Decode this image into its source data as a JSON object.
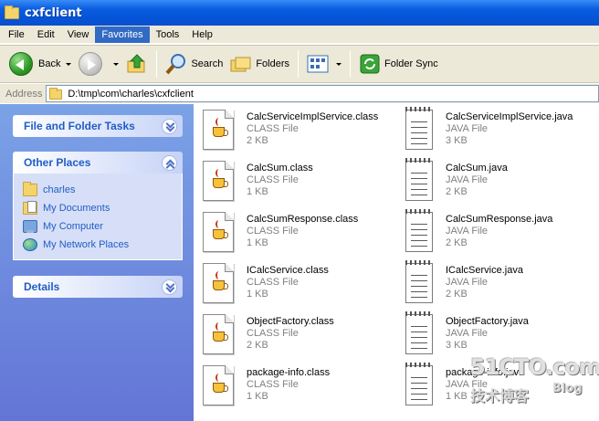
{
  "window": {
    "title": "cxfclient"
  },
  "menu": [
    "File",
    "Edit",
    "View",
    "Favorites",
    "Tools",
    "Help"
  ],
  "menu_active": "Favorites",
  "toolbar": {
    "back": "Back",
    "search": "Search",
    "folders": "Folders",
    "folder_sync": "Folder Sync"
  },
  "address": {
    "label": "Address",
    "path": "D:\\tmp\\com\\charles\\cxfclient"
  },
  "tasks": {
    "file_folder_tasks": "File and Folder Tasks",
    "other_places": "Other Places",
    "details": "Details",
    "places": [
      {
        "label": "charles",
        "icon": "folder-icon"
      },
      {
        "label": "My Documents",
        "icon": "my-documents-icon"
      },
      {
        "label": "My Computer",
        "icon": "my-computer-icon"
      },
      {
        "label": "My Network Places",
        "icon": "network-places-icon"
      }
    ]
  },
  "files": [
    {
      "name": "CalcServiceImplService.class",
      "type": "CLASS File",
      "size": "2 KB",
      "kind": "class"
    },
    {
      "name": "CalcServiceImplService.java",
      "type": "JAVA File",
      "size": "3 KB",
      "kind": "java"
    },
    {
      "name": "CalcSum.class",
      "type": "CLASS File",
      "size": "1 KB",
      "kind": "class"
    },
    {
      "name": "CalcSum.java",
      "type": "JAVA File",
      "size": "2 KB",
      "kind": "java"
    },
    {
      "name": "CalcSumResponse.class",
      "type": "CLASS File",
      "size": "1 KB",
      "kind": "class"
    },
    {
      "name": "CalcSumResponse.java",
      "type": "JAVA File",
      "size": "2 KB",
      "kind": "java"
    },
    {
      "name": "ICalcService.class",
      "type": "CLASS File",
      "size": "1 KB",
      "kind": "class"
    },
    {
      "name": "ICalcService.java",
      "type": "JAVA File",
      "size": "2 KB",
      "kind": "java"
    },
    {
      "name": "ObjectFactory.class",
      "type": "CLASS File",
      "size": "2 KB",
      "kind": "class"
    },
    {
      "name": "ObjectFactory.java",
      "type": "JAVA File",
      "size": "3 KB",
      "kind": "java"
    },
    {
      "name": "package-info.class",
      "type": "CLASS File",
      "size": "1 KB",
      "kind": "class"
    },
    {
      "name": "package-info.java",
      "type": "JAVA File",
      "size": "1 KB",
      "kind": "java"
    }
  ],
  "watermark": {
    "site": "51CTO.com",
    "cn": "技术博客",
    "blog": "Blog"
  }
}
